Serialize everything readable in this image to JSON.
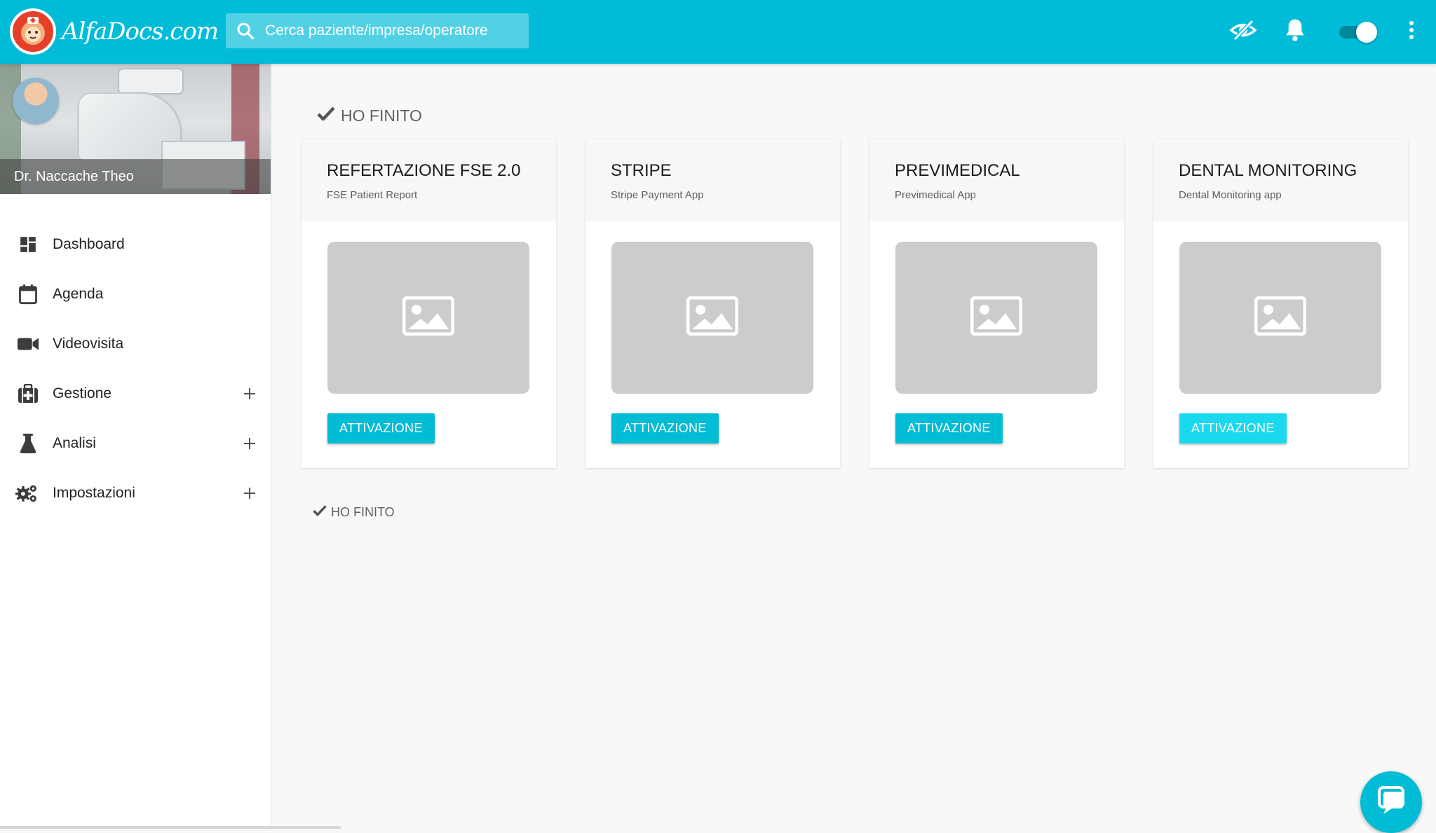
{
  "brand": {
    "logo_text": "AlfaDocs.com",
    "primary_color": "#00bcd9",
    "accent_color": "#e53f2a"
  },
  "header": {
    "search": {
      "placeholder": "Cerca paziente/impresa/operatore",
      "value": ""
    },
    "icons": [
      "eye-slash-icon",
      "bell-icon",
      "toggle-switch",
      "more-vert-icon"
    ],
    "toggle_on": true
  },
  "sidebar": {
    "profile": {
      "name": "Dr. Naccache Theo"
    },
    "items": [
      {
        "label": "Dashboard",
        "icon": "dashboard-icon",
        "expandable": false
      },
      {
        "label": "Agenda",
        "icon": "calendar-icon",
        "expandable": false
      },
      {
        "label": "Videovisita",
        "icon": "video-camera-icon",
        "expandable": false
      },
      {
        "label": "Gestione",
        "icon": "medkit-icon",
        "expandable": true,
        "expand_symbol": "+"
      },
      {
        "label": "Analisi",
        "icon": "flask-icon",
        "expandable": true,
        "expand_symbol": "+"
      },
      {
        "label": "Impostazioni",
        "icon": "gears-icon",
        "expandable": true,
        "expand_symbol": "+"
      }
    ]
  },
  "main": {
    "section_title": "HO FINITO",
    "footer_title": "HO FINITO",
    "cards": [
      {
        "title": "REFERTAZIONE FSE 2.0",
        "subtitle": "FSE Patient Report",
        "button": "ATTIVAZIONE",
        "image": "image-placeholder-icon"
      },
      {
        "title": "STRIPE",
        "subtitle": "Stripe Payment App",
        "button": "ATTIVAZIONE",
        "image": "image-placeholder-icon"
      },
      {
        "title": "PREVIMEDICAL",
        "subtitle": "Previmedical App",
        "button": "ATTIVAZIONE",
        "image": "image-placeholder-icon"
      },
      {
        "title": "DENTAL MONITORING",
        "subtitle": "Dental Monitoring app",
        "button": "ATTIVAZIONE",
        "image": "image-placeholder-icon"
      }
    ]
  },
  "chat": {
    "icon": "chat-bubble-icon"
  }
}
